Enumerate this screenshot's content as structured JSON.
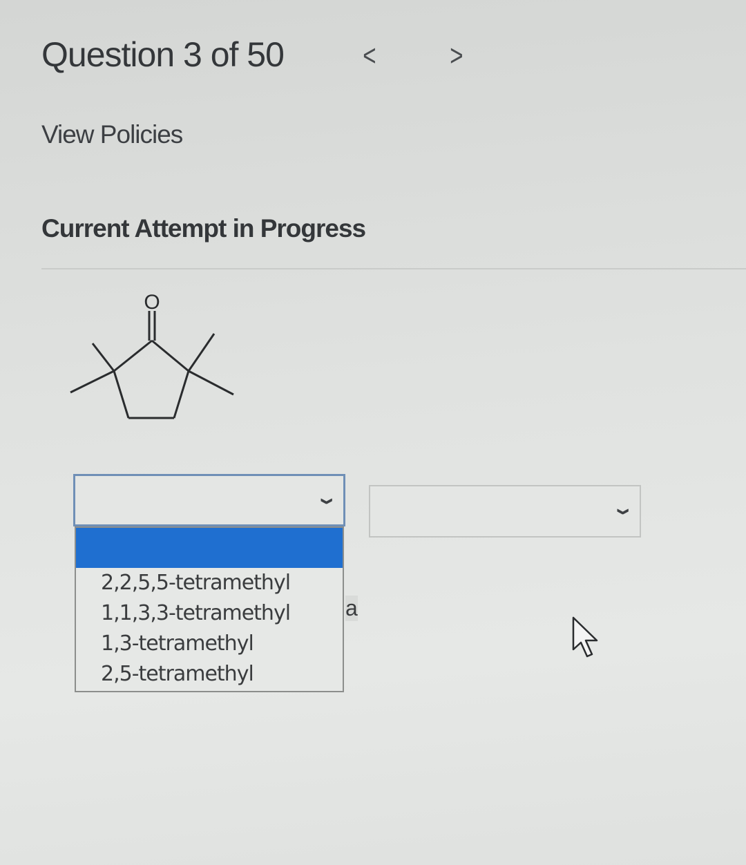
{
  "header": {
    "question_label": "Question 3 of 50",
    "prev_symbol": "<",
    "next_symbol": ">"
  },
  "links": {
    "view_policies": "View Policies"
  },
  "status": {
    "attempt_label": "Current Attempt in Progress"
  },
  "structure": {
    "atom_label": "O"
  },
  "select_prefix": {
    "selected_value": "",
    "options": [
      "",
      "2,2,5,5-tetramethyl",
      "1,1,3,3-tetramethyl",
      "1,3-tetramethyl",
      "2,5-tetramethyl"
    ]
  },
  "select_parent": {
    "selected_value": ""
  },
  "partial_text": "a",
  "colors": {
    "highlight": "#1f6fd0",
    "focus_border": "#6f8fb6"
  }
}
